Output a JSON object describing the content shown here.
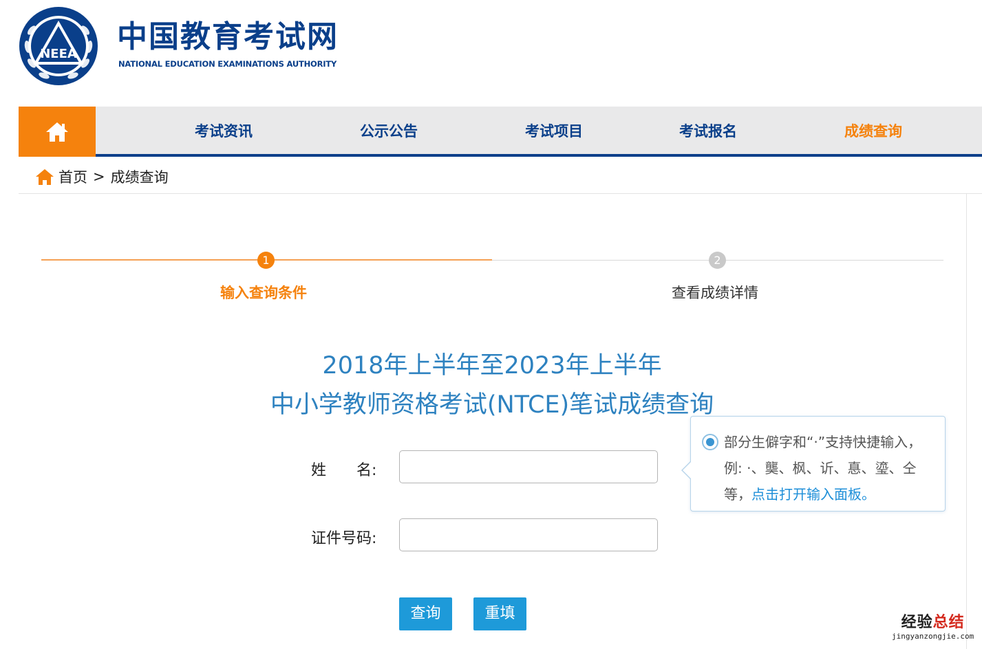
{
  "header": {
    "logo_cn": "中国教育考试网",
    "logo_en": "NATIONAL EDUCATION EXAMINATIONS AUTHORITY",
    "emblem_text": "NEEA",
    "brand_color": "#0a3f8a"
  },
  "nav": {
    "home_icon": "home-icon",
    "items": [
      {
        "label": "考试资讯"
      },
      {
        "label": "公示公告"
      },
      {
        "label": "考试项目"
      },
      {
        "label": "考试报名"
      },
      {
        "label": "成绩查询",
        "active": true
      }
    ],
    "accent_color": "#f5820d"
  },
  "breadcrumb": {
    "home": "首页",
    "separator": ">",
    "current": "成绩查询"
  },
  "steps": [
    {
      "number": "1",
      "label": "输入查询条件",
      "active": true
    },
    {
      "number": "2",
      "label": "查看成绩详情",
      "active": false
    }
  ],
  "title": {
    "line1": "2018年上半年至2023年上半年",
    "line2": "中小学教师资格考试(NTCE)笔试成绩查询"
  },
  "form": {
    "name_label": "姓　　名:",
    "name_value": "",
    "id_label": "证件号码:",
    "id_value": ""
  },
  "tip": {
    "text": "部分生僻字和“·”支持快捷输入，例: ·、龑、枫、䜣、惪、瑬、仝等，",
    "link": "点击打开输入面板。"
  },
  "buttons": {
    "query": "查询",
    "reset": "重填"
  },
  "watermark": {
    "cn_part1": "经验",
    "cn_part2": "总结",
    "en": "jingyanzongjie.com"
  }
}
